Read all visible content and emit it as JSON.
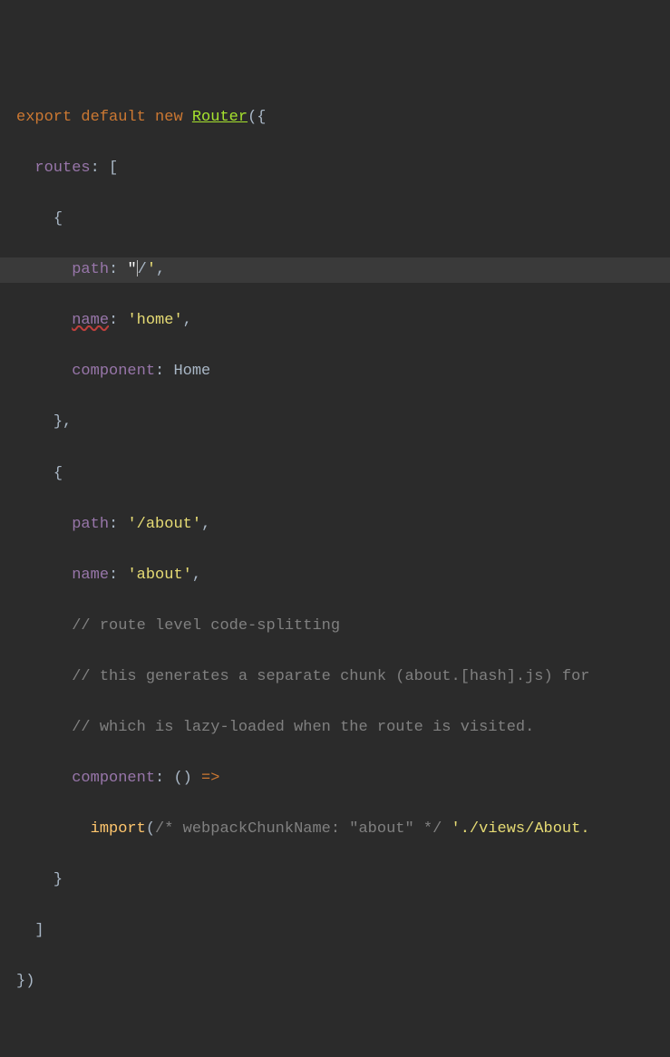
{
  "code": {
    "line1": {
      "export": "export",
      "default": "default",
      "new": "new",
      "router": "Router",
      "open": "({"
    },
    "line2": {
      "routes": "routes",
      "colon": ":",
      "bracket": " ["
    },
    "line3": {
      "brace": "{"
    },
    "line4": {
      "path": "path",
      "colon": ":",
      "q1": "\"",
      "val": "/",
      "q2": "'",
      "comma": ","
    },
    "line5": {
      "name": "name",
      "colon": ":",
      "val": "'home'",
      "comma": ","
    },
    "line6": {
      "component": "component",
      "colon": ":",
      "val": " Home"
    },
    "line7": {
      "brace": "},"
    },
    "line8": {
      "brace": "{"
    },
    "line9": {
      "path": "path",
      "colon": ":",
      "val": "'/about'",
      "comma": ","
    },
    "line10": {
      "name": "name",
      "colon": ":",
      "val": "'about'",
      "comma": ","
    },
    "line11": {
      "comment": "// route level code-splitting"
    },
    "line12": {
      "comment": "// this generates a separate chunk (about.[hash].js) for"
    },
    "line13": {
      "comment": "// which is lazy-loaded when the route is visited."
    },
    "line14": {
      "component": "component",
      "colon": ":",
      "parens": " ()",
      "arrow": " =>"
    },
    "line15": {
      "import": "import",
      "open": "(",
      "webpack": "/* webpackChunkName: \"about\" */",
      "path": "'./views/About.",
      "space": " "
    },
    "line16": {
      "brace": "}"
    },
    "line17": {
      "bracket": "]"
    },
    "line18": {
      "close": "})"
    }
  }
}
